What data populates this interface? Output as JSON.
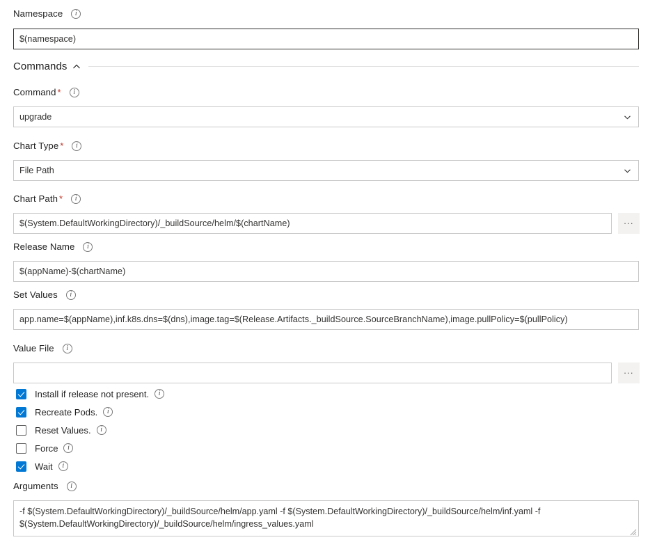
{
  "colors": {
    "accent": "#0078d4",
    "required_asterisk": "#c0392b",
    "border": "#c8c8c8",
    "focused_border": "#323130",
    "text": "#212121",
    "divider": "#e1e1e1",
    "browse_button_bg": "#f3f2f1"
  },
  "icons": {
    "info": "info-icon",
    "chevron_down": "chevron-down-icon",
    "chevron_up": "chevron-up-icon",
    "ellipsis": "…",
    "browse_label": "..."
  },
  "fields": {
    "namespace": {
      "label": "Namespace",
      "required": false,
      "value": "$(namespace)",
      "placeholder": ""
    },
    "command": {
      "label": "Command",
      "required": true,
      "value": "upgrade"
    },
    "chart_type": {
      "label": "Chart Type",
      "required": true,
      "value": "File Path"
    },
    "chart_path": {
      "label": "Chart Path",
      "required": true,
      "value": "$(System.DefaultWorkingDirectory)/_buildSource/helm/$(chartName)",
      "placeholder": ""
    },
    "release_name": {
      "label": "Release Name",
      "required": false,
      "value": "$(appName)-$(chartName)",
      "placeholder": ""
    },
    "set_values": {
      "label": "Set Values",
      "required": false,
      "value": "app.name=$(appName),inf.k8s.dns=$(dns),image.tag=$(Release.Artifacts._buildSource.SourceBranchName),image.pullPolicy=$(pullPolicy)",
      "placeholder": ""
    },
    "value_file": {
      "label": "Value File",
      "required": false,
      "value": "",
      "placeholder": ""
    },
    "arguments": {
      "label": "Arguments",
      "required": false,
      "value": "-f $(System.DefaultWorkingDirectory)/_buildSource/helm/app.yaml -f $(System.DefaultWorkingDirectory)/_buildSource/helm/inf.yaml -f $(System.DefaultWorkingDirectory)/_buildSource/helm/ingress_values.yaml",
      "placeholder": ""
    }
  },
  "section": {
    "commands": {
      "title": "Commands",
      "expanded": true
    }
  },
  "checkboxes": [
    {
      "label": "Install if release not present.",
      "checked": true
    },
    {
      "label": "Recreate Pods.",
      "checked": true
    },
    {
      "label": "Reset Values.",
      "checked": false
    },
    {
      "label": "Force",
      "checked": false
    },
    {
      "label": "Wait",
      "checked": true
    }
  ]
}
